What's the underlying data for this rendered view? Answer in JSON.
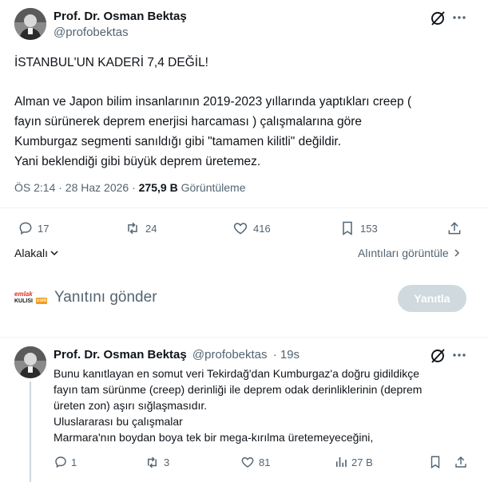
{
  "main_post": {
    "author_name": "Prof. Dr. Osman Bektaş",
    "author_handle": "@profobektas",
    "title_line": "İSTANBUL'UN KADERİ 7,4 DEĞİL!",
    "body_lines": [
      "Alman ve Japon bilim insanlarının 2019-2023 yıllarında yaptıkları creep (",
      "fayın sürünerek deprem enerjisi harcaması ) çalışmalarına göre",
      "Kumburgaz segmenti sanıldığı gibi \"tamamen kilitli\" değildir.",
      "Yani beklendiği gibi büyük deprem üretemez."
    ],
    "timestamp": "ÖS 2:14 · 28 Haz 2026 · ",
    "views_count": "275,9 B",
    "views_label": " Görüntüleme",
    "stats": {
      "replies": "17",
      "reposts": "24",
      "likes": "416",
      "bookmarks": "153"
    },
    "relevance_label": "Alakalı",
    "quotes_link": "Alıntıları görüntüle"
  },
  "reply_composer": {
    "avatar_text_top": "emlak",
    "avatar_text_bottom": "KULISI",
    "avatar_badge": "com",
    "placeholder": "Yanıtını gönder",
    "submit_label": "Yanıtla"
  },
  "reply_post": {
    "author_name": "Prof. Dr. Osman Bektaş",
    "author_handle": "@profobektas",
    "time": "· 19s",
    "body_lines": [
      "Bunu kanıtlayan en somut veri Tekirdağ'dan Kumburgaz'a doğru gidildikçe",
      "fayın tam sürünme (creep) derinliği ile deprem odak derinliklerinin (deprem",
      "üreten zon) aşırı sığlaşmasıdır.",
      "Uluslararası bu çalışmalar",
      "Marmara'nın boydan boya tek bir mega-kırılma üretemeyeceğini,"
    ],
    "stats": {
      "replies": "1",
      "reposts": "3",
      "likes": "81",
      "views": "27 B"
    }
  },
  "colors": {
    "text": "#0f1419",
    "muted": "#536471",
    "divider": "#eff3f4",
    "disabled_button": "#cfd9de",
    "composer_logo_red": "#e0301e",
    "composer_logo_orange": "#f59a1b"
  }
}
